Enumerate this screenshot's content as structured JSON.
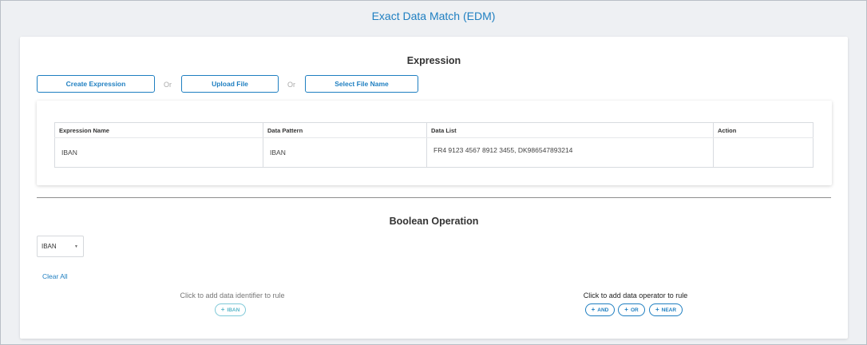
{
  "page": {
    "title": "Exact Data Match (EDM)"
  },
  "expression": {
    "title": "Expression",
    "buttons": {
      "create": "Create Expression",
      "upload": "Upload File",
      "select": "Select File Name"
    },
    "or_label": "Or",
    "table": {
      "headers": [
        "Expression Name",
        "Data Pattern",
        "Data List",
        "Action"
      ],
      "rows": [
        {
          "name": "IBAN",
          "pattern": "IBAN",
          "list": "FR4 9123 4567 8912 3455, DK986547893214",
          "action": ""
        }
      ]
    }
  },
  "boolean": {
    "title": "Boolean Operation",
    "select": {
      "value": "IBAN"
    },
    "clear_all": "Clear All",
    "identifiers": {
      "hint": "Click to add data identifier to rule",
      "chips": [
        "IBAN"
      ]
    },
    "operators": {
      "hint": "Click to add data operator to rule",
      "chips": [
        "AND",
        "OR",
        "NEAR"
      ]
    }
  },
  "colors": {
    "accent": "#1f7fc1",
    "chip_light": "#5bb7c9"
  },
  "icons": {
    "chip_add": "plus-icon",
    "select_caret": "caret-down-icon"
  }
}
